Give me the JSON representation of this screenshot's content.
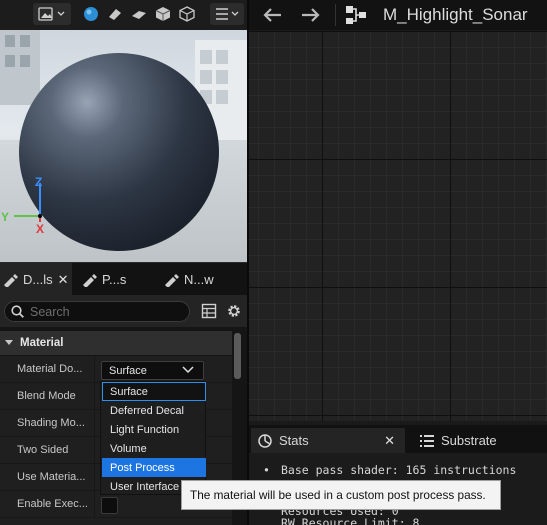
{
  "viewport": {
    "axis_labels": {
      "z": "Z",
      "y": "Y",
      "x": "X"
    }
  },
  "graph": {
    "title": "M_Highlight_Sonar"
  },
  "details": {
    "tabs": [
      {
        "label": "D...ls",
        "active": true,
        "closable": true
      },
      {
        "label": "P...s",
        "active": false
      },
      {
        "label": "N...w",
        "active": false
      }
    ],
    "search_placeholder": "Search",
    "category": "Material",
    "properties": [
      "Material Do...",
      "Blend Mode",
      "Shading Mo...",
      "Two Sided",
      "Use Materia...",
      "Enable Exec..."
    ],
    "material_domain_value": "Surface"
  },
  "dropdown": {
    "options": [
      "Surface",
      "Deferred Decal",
      "Light Function",
      "Volume",
      "Post Process",
      "User Interface"
    ],
    "hovered": "Surface",
    "selected": "Post Process"
  },
  "tooltip": {
    "text": "The material will be used in a custom post process pass."
  },
  "stats": {
    "tabs": [
      {
        "label": "Stats",
        "active": true,
        "closable": true
      },
      {
        "label": "Substrate",
        "active": false
      }
    ],
    "bullet": "•",
    "lines": [
      "Base pass shader: 165 instructions",
      "Resources Used: 0",
      "RW Resource Limit: 8"
    ]
  },
  "colors": {
    "selection": "#1c75e0",
    "hover_outline": "#2e8ff2",
    "axis_z": "#3a8fff",
    "axis_y": "#5fc34a",
    "axis_x": "#e03a3a"
  }
}
